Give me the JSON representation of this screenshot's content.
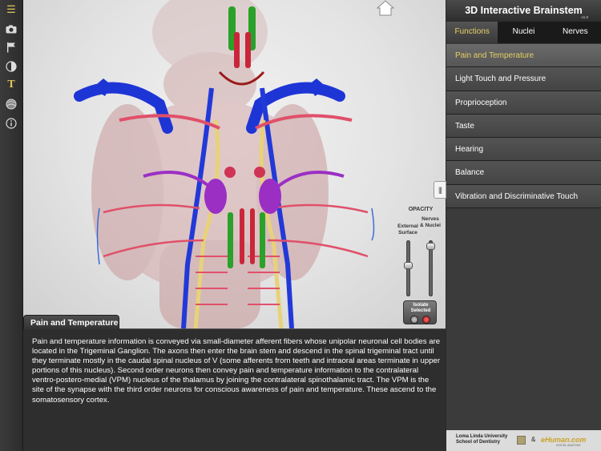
{
  "app": {
    "title": "3D Interactive Brainstem",
    "version": "v1.0"
  },
  "toolbar": {
    "icons": [
      "menu-list-icon",
      "camera-icon",
      "flag-icon",
      "half-circle-icon",
      "text-icon",
      "globe-icon",
      "info-icon"
    ]
  },
  "tabs": [
    {
      "label": "Functions",
      "active": true
    },
    {
      "label": "Nuclei",
      "active": false
    },
    {
      "label": "Nerves",
      "active": false
    }
  ],
  "functions": [
    {
      "label": "Pain and Temperature",
      "selected": true
    },
    {
      "label": "Light Touch and Pressure",
      "selected": false
    },
    {
      "label": "Proprioception",
      "selected": false
    },
    {
      "label": "Taste",
      "selected": false
    },
    {
      "label": "Hearing",
      "selected": false
    },
    {
      "label": "Balance",
      "selected": false
    },
    {
      "label": "Vibration and Discriminative Touch",
      "selected": false
    }
  ],
  "opacity": {
    "title": "OPACITY",
    "external_label": "External Surface",
    "nerves_label": "Nerves & Nuclei",
    "external_level": 0.55,
    "nerves_level": 0.95,
    "isolate_label": "Isolate Selected"
  },
  "info": {
    "title": "Pain and Temperature",
    "body": "Pain and temperature information is conveyed via small-diameter afferent fibers whose unipolar neuronal cell bodies are located in the Trigeminal Ganglion.  The axons then enter the brain stem and descend in the spinal trigeminal tract until they terminate mostly in the caudal spinal nucleus of V (some afferents from teeth and intraoral areas terminate in upper portions of this nucleus).  Second order neurons then convey pain and temperature information to the contralateral ventro-postero-medial (VPM) nucleus of the thalamus by joining the contralateral spinothalamic tract.  The VPM is the site of the  synapse with the third order neurons for conscious awareness of pain and temperature.  These ascend to the somatosensory cortex."
  },
  "footer": {
    "school": "Loma Linda University",
    "school_sub": "School of Dentistry",
    "amp": "&",
    "partner": "eHuman.com",
    "partner_sub": "DIGITAL ANATOMY"
  },
  "colors": {
    "accent": "#e6cf63",
    "nerve_blue": "#1e35d6",
    "tract_yellow": "#e7d27a",
    "nucleus_red": "#c9263a",
    "nucleus_green": "#2aa12a",
    "nucleus_purple": "#9b2fc4",
    "vessel_pink": "#e0506a"
  }
}
